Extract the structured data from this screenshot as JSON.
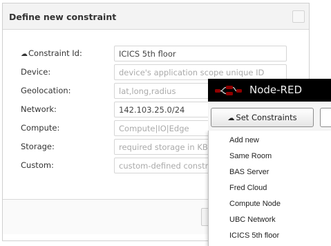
{
  "dialog": {
    "title": "Define new constraint",
    "fields": [
      {
        "label": "Constraint Id:",
        "value": "ICICS 5th floor",
        "placeholder": ""
      },
      {
        "label": "Device:",
        "value": "",
        "placeholder": "device's application scope unique ID"
      },
      {
        "label": "Geolocation:",
        "value": "",
        "placeholder": "lat,long,radius"
      },
      {
        "label": "Network:",
        "value": "142.103.25.0/24",
        "placeholder": ""
      },
      {
        "label": "Compute:",
        "value": "",
        "placeholder": "Compute|IO|Edge"
      },
      {
        "label": "Storage:",
        "value": "",
        "placeholder": "required storage in KB"
      },
      {
        "label": "Custom:",
        "value": "",
        "placeholder": "custom-defined constraint"
      }
    ]
  },
  "nodered": {
    "title": "Node-RED",
    "set_constraints_label": "Set Constraints",
    "menu": [
      "Add new",
      "Same Room",
      "BAS Server",
      "Fred Cloud",
      "Compute Node",
      "UBC Network",
      "ICICS 5th floor"
    ]
  },
  "icons": {
    "cloud": "cloud-icon",
    "logo": "node-red-logo-icon"
  },
  "colors": {
    "header_bg": "#000000",
    "logo_red": "#8f0000"
  }
}
